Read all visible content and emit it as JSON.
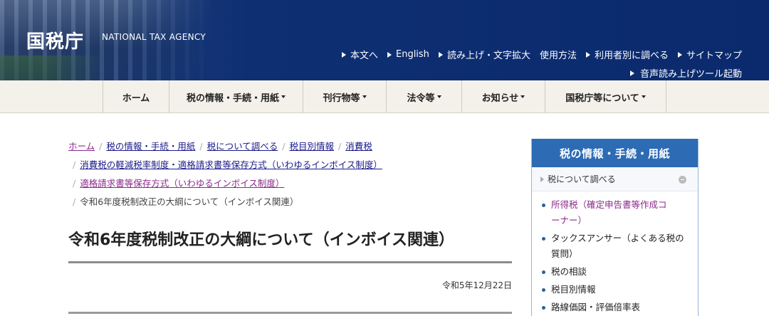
{
  "header": {
    "logo": "国税庁",
    "logo_en": "NATIONAL TAX AGENCY",
    "util_links": [
      "本文へ",
      "English",
      "読み上げ・文字拡大",
      "使用方法",
      "利用者別に調べる",
      "サイトマップ"
    ],
    "voice_link": "音声読み上げツール起動"
  },
  "nav": {
    "items": [
      {
        "label": "ホーム",
        "width": 93
      },
      {
        "label": "税の情報・手続・用紙",
        "width": 188
      },
      {
        "label": "刊行物等",
        "width": 117
      },
      {
        "label": "法令等",
        "width": 106
      },
      {
        "label": "お知らせ",
        "width": 117
      },
      {
        "label": "国税庁等について",
        "width": 170
      },
      {
        "label": "",
        "width": 0
      }
    ]
  },
  "breadcrumb": {
    "line1": [
      "ホーム",
      "税の情報・手続・用紙",
      "税について調べる",
      "税目別情報",
      "消費税"
    ],
    "line2": "消費税の軽減税率制度・適格請求書等保存方式（いわゆるインボイス制度）",
    "line3": "適格請求書等保存方式（いわゆるインボイス制度）",
    "current": "令和6年度税制改正の大綱について（インボイス関連）"
  },
  "page": {
    "title": "令和6年度税制改正の大綱について（インボイス関連）",
    "date": "令和5年12月22日"
  },
  "sidebar": {
    "title": "税の情報・手続・用紙",
    "subheading": "税について調べる",
    "items": [
      {
        "label": "所得税（確定申告書等作成コーナー）",
        "line1": "所得税（確定申告書等作成コ",
        "line2": "ーナー）"
      },
      {
        "label": "タックスアンサー（よくある税の質問）",
        "line1": "タックスアンサー（よくある税の",
        "line2": "質問）"
      },
      {
        "label": "税の相談"
      },
      {
        "label": "税目別情報"
      },
      {
        "label": "路線価図・評価倍率表"
      }
    ]
  }
}
